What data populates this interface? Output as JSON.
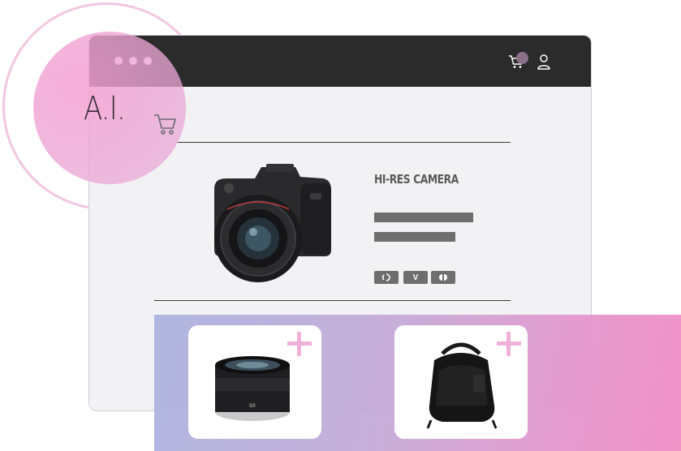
{
  "logo": {
    "text": "A.I.",
    "icon": "cart-icon"
  },
  "window": {
    "menu_icon": "three-dots-icon",
    "cart_icon": "cart-icon",
    "user_icon": "user-icon"
  },
  "product": {
    "title": "HI-RES CAMERA",
    "image": "camera-image",
    "options": [
      {
        "icon": "option-icon-1",
        "label": ""
      },
      {
        "icon": "option-icon-2",
        "label": "V"
      },
      {
        "icon": "option-icon-3",
        "label": ""
      }
    ]
  },
  "accessories": [
    {
      "image": "lens-image",
      "add_icon": "plus-icon"
    },
    {
      "image": "camera-bag-image",
      "add_icon": "plus-icon"
    }
  ],
  "colors": {
    "titlebar": "#2b2b2b",
    "window_bg": "#f2f2f5",
    "accent_pink": "#f0a8d4",
    "cart_badge": "#8a6f89"
  }
}
